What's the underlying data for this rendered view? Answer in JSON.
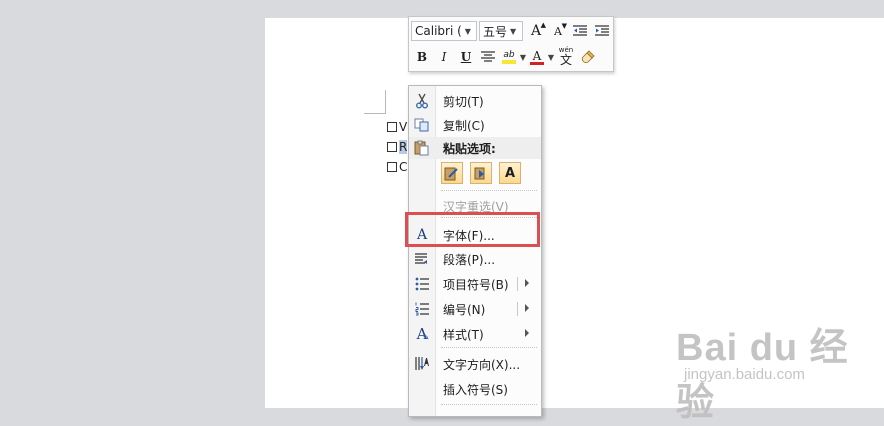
{
  "document": {
    "lines": [
      {
        "text": "V",
        "selected": false
      },
      {
        "text": "R",
        "selected": true
      },
      {
        "text": "C",
        "selected": false
      }
    ]
  },
  "mini_toolbar": {
    "font_name": "Calibri (",
    "font_size": "五号",
    "grow_font_icon": "A",
    "shrink_font_icon": "A",
    "bold_label": "B",
    "italic_label": "I",
    "underline_label": "U",
    "highlight_label": "ab",
    "font_color_label": "A",
    "phonetic_label": "文",
    "phonetic_sup": "wén",
    "accent_highlight": "#f5e733",
    "accent_font_color": "#d22222"
  },
  "context_menu": {
    "cut": "剪切(T)",
    "copy": "复制(C)",
    "paste_options": "粘贴选项:",
    "paste_text_only_label": "A",
    "reconvert": "汉字重选(V)",
    "font": "字体(F)...",
    "paragraph": "段落(P)...",
    "bullets": "项目符号(B)",
    "numbering": "编号(N)",
    "styles": "样式(T)",
    "text_direction": "文字方向(X)...",
    "insert_symbol": "插入符号(S)",
    "font_icon_label": "A",
    "styles_icon_label": "A"
  },
  "highlight": {
    "color": "#dc4e4f"
  },
  "watermark": {
    "main": "Bai du 经验",
    "sub": "jingyan.baidu.com"
  }
}
